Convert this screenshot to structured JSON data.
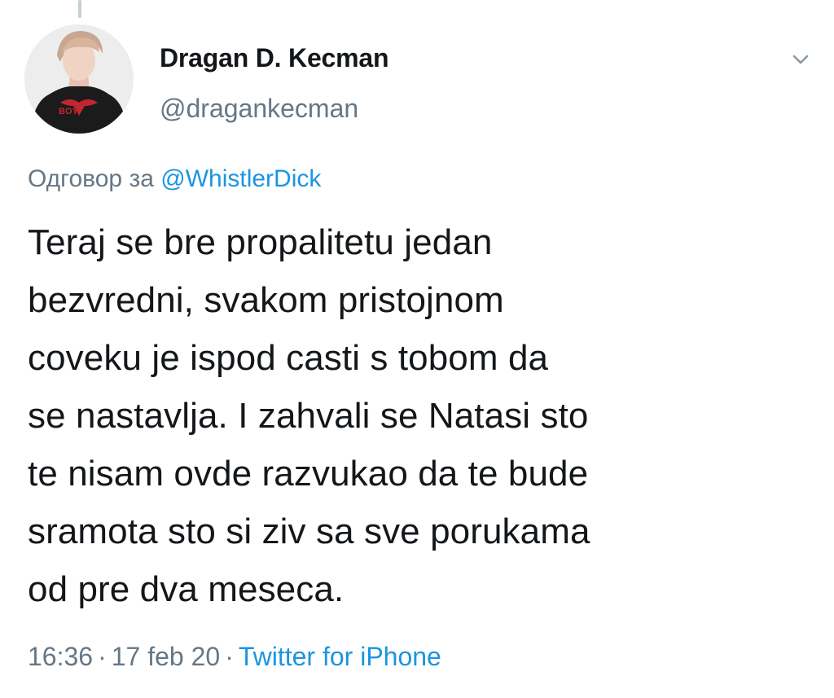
{
  "author": {
    "display_name": "Dragan D. Kecman",
    "handle": "@dragankecman",
    "avatar_shirt_text": "BOY"
  },
  "menu": {
    "icon": "chevron-down-icon"
  },
  "reply": {
    "prefix": "Одговор за",
    "target": "@WhistlerDick"
  },
  "tweet": {
    "lines": [
      "Teraj se bre propalitetu jedan",
      "bezvredni, svakom pristojnom",
      "coveku je ispod casti s tobom da",
      "se nastavlja. I zahvali se Natasi sto",
      "te nisam ovde razvukao da te bude",
      "sramota sto si ziv sa sve porukama",
      "od pre dva meseca."
    ]
  },
  "meta": {
    "time": "16:36",
    "date": "17 feb 20",
    "separator": "·",
    "source": "Twitter for iPhone"
  },
  "colors": {
    "text": "#14171a",
    "secondary": "#657786",
    "link": "#1b95e0"
  }
}
